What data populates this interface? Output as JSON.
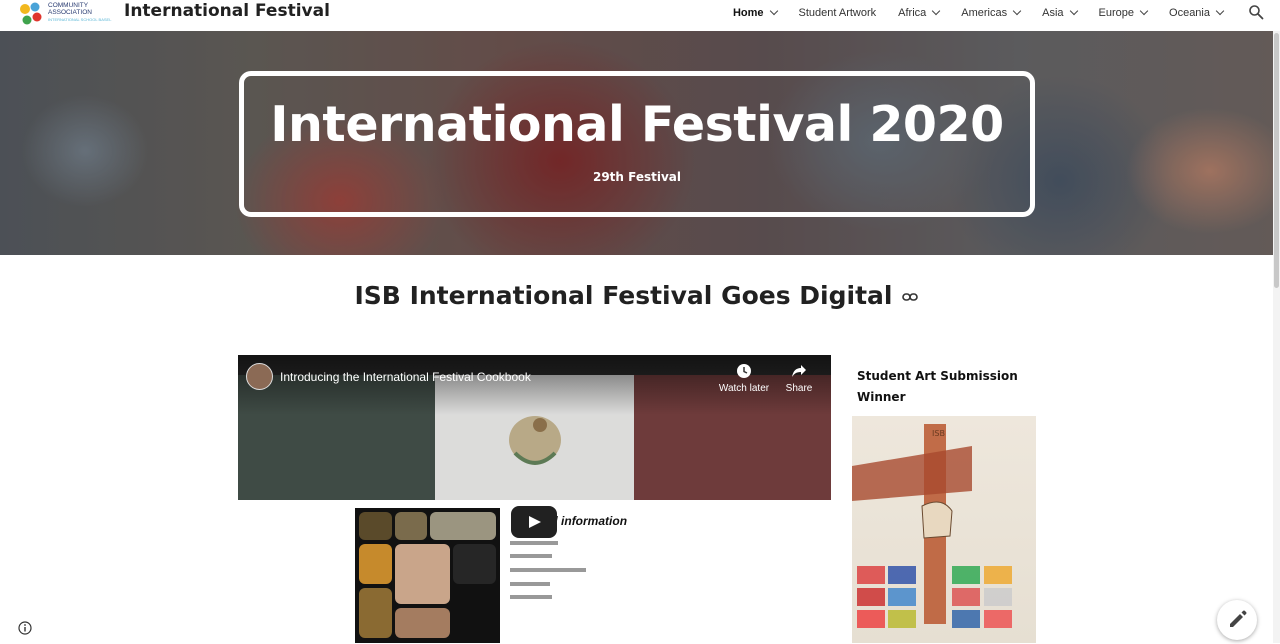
{
  "header": {
    "logo_line1": "COMMUNITY",
    "logo_line2": "ASSOCIATION",
    "logo_line3": "INTERNATIONAL SCHOOL BASEL",
    "site_title": "International Festival",
    "nav": [
      {
        "label": "Home",
        "active": true,
        "dropdown": true
      },
      {
        "label": "Student Artwork",
        "active": false,
        "dropdown": false
      },
      {
        "label": "Africa",
        "active": false,
        "dropdown": true
      },
      {
        "label": "Americas",
        "active": false,
        "dropdown": true
      },
      {
        "label": "Asia",
        "active": false,
        "dropdown": true
      },
      {
        "label": "Europe",
        "active": false,
        "dropdown": true
      },
      {
        "label": "Oceania",
        "active": false,
        "dropdown": true
      }
    ],
    "search_icon": "search-icon"
  },
  "hero": {
    "title": "International Festival 2020",
    "subtitle": "29th Festival"
  },
  "section": {
    "title": "ISB International Festival Goes Digital",
    "link_icon": "link-icon"
  },
  "video": {
    "title": "Introducing the International Festival Cookbook",
    "watch_later": "Watch later",
    "share": "Share",
    "info_heading": "General information"
  },
  "sidebar": {
    "art_title": "Student Art Submission Winner"
  },
  "colors": {
    "text": "#212121",
    "flag_green": "#3f4b45",
    "flag_red": "#6e3b3b"
  }
}
